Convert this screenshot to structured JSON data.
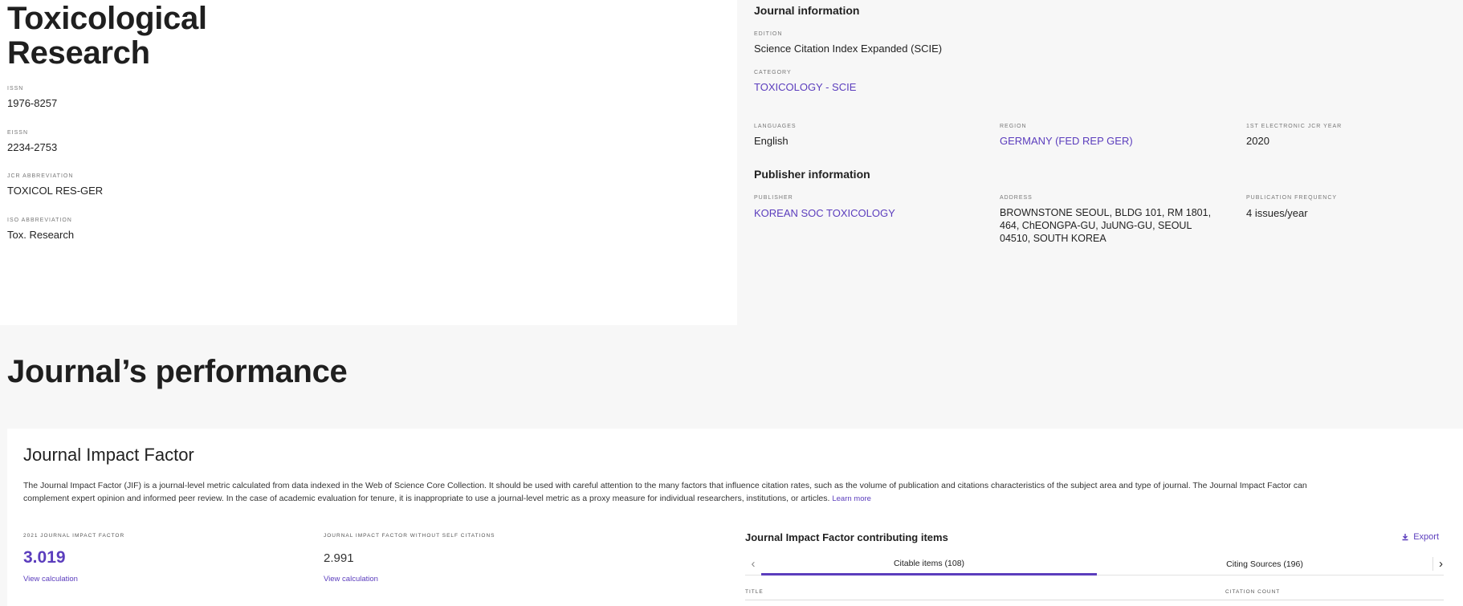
{
  "journal": {
    "title": "Toxicological Research",
    "issn_label": "ISSN",
    "issn": "1976-8257",
    "eissn_label": "EISSN",
    "eissn": "2234-2753",
    "jcr_abbrev_label": "JCR ABBREVIATION",
    "jcr_abbrev": "TOXICOL RES-GER",
    "iso_abbrev_label": "ISO ABBREVIATION",
    "iso_abbrev": "Tox. Research"
  },
  "journal_info": {
    "heading": "Journal information",
    "edition_label": "EDITION",
    "edition": "Science Citation Index Expanded (SCIE)",
    "category_label": "CATEGORY",
    "category": "TOXICOLOGY - SCIE",
    "languages_label": "LANGUAGES",
    "languages": "English",
    "region_label": "REGION",
    "region": "GERMANY (FED REP GER)",
    "electronic_year_label": "1ST ELECTRONIC JCR YEAR",
    "electronic_year": "2020"
  },
  "publisher_info": {
    "heading": "Publisher information",
    "publisher_label": "PUBLISHER",
    "publisher": "KOREAN SOC TOXICOLOGY",
    "address_label": "ADDRESS",
    "address_line1": "BROWNSTONE SEOUL, BLDG 101, RM 1801,",
    "address_line2": "464, ChEONGPA-GU, JuUNG-GU, SEOUL",
    "address_line3": "04510, SOUTH KOREA",
    "frequency_label": "PUBLICATION FREQUENCY",
    "frequency": "4 issues/year"
  },
  "performance": {
    "heading": "Journal’s performance",
    "card_title": "Journal Impact Factor",
    "description": "The Journal Impact Factor (JIF) is a journal-level metric calculated from data indexed in the Web of Science Core Collection. It should be used with careful attention to the many factors that influence citation rates, such as the volume of publication and citations characteristics of the subject area and type of journal. The Journal Impact Factor can complement expert opinion and informed peer review. In the case of academic evaluation for tenure, it is inappropriate to use a journal-level metric as a proxy measure for individual researchers, institutions, or articles.",
    "learn_more": "Learn more",
    "jif_label": "2021 JOURNAL IMPACT FACTOR",
    "jif_value": "3.019",
    "jif_link": "View calculation",
    "jif_noself_label": "JOURNAL IMPACT FACTOR WITHOUT SELF CITATIONS",
    "jif_noself_value": "2.991",
    "jif_noself_link": "View calculation"
  },
  "contributing": {
    "title": "Journal Impact Factor contributing items",
    "export_label": "Export",
    "tabs": [
      {
        "label": "Citable items (108)"
      },
      {
        "label": "Citing Sources (196)"
      }
    ],
    "col_title": "TITLE",
    "col_count": "CITATION COUNT"
  },
  "colors": {
    "accent": "#5b3dbd"
  }
}
